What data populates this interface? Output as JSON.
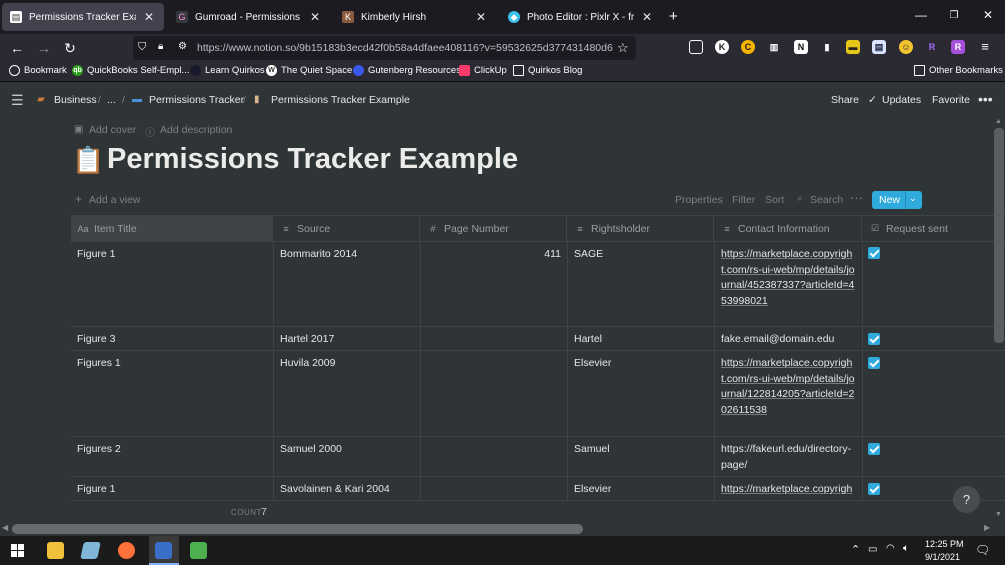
{
  "browser": {
    "tabs": [
      {
        "label": "Permissions Tracker Example",
        "active": true,
        "icon": "notion-page-icon"
      },
      {
        "label": "Gumroad - Permissions Tracker",
        "active": false,
        "icon": "gumroad-icon"
      },
      {
        "label": "Kimberly Hirsh",
        "active": false,
        "icon": "hirsh-icon"
      },
      {
        "label": "Photo Editor : Pixlr X - free imag",
        "active": false,
        "icon": "pixlr-icon"
      }
    ],
    "url": "https://www.notion.so/9b15183b3ecd42f0b58a4dfaee408116?v=59532625d377431480d6",
    "bookmarks": [
      {
        "label": "Bookmark",
        "icon": "globe-icon",
        "color": "#e6e6e5"
      },
      {
        "label": "QuickBooks Self-Empl...",
        "icon": "quickbooks-icon",
        "color": "#2ca01c"
      },
      {
        "label": "Learn Quirkos",
        "icon": "quirkos-icon",
        "color": "#1a1a2e"
      },
      {
        "label": "The Quiet Space",
        "icon": "wordpress-icon",
        "color": "#e6e6e5"
      },
      {
        "label": "Gutenberg Resources",
        "icon": "gutenberg-icon",
        "color": "#3858e9"
      },
      {
        "label": "ClickUp",
        "icon": "clickup-icon",
        "color": "#ff3b6b"
      },
      {
        "label": "Quirkos Blog",
        "icon": "folder-icon",
        "color": "#e6e6e5"
      }
    ],
    "other_bookmarks": "Other Bookmarks"
  },
  "notion": {
    "breadcrumbs": [
      "Business",
      "...",
      "Permissions Tracker",
      "Permissions Tracker Example"
    ],
    "share": "Share",
    "updates": "Updates",
    "favorite": "Favorite",
    "add_cover": "Add cover",
    "add_description": "Add description",
    "page_title": "Permissions Tracker Example",
    "page_emoji": "📋",
    "add_view": "Add a view",
    "toolbar": {
      "properties": "Properties",
      "filter": "Filter",
      "sort": "Sort",
      "search": "Search",
      "new": "New"
    },
    "columns": [
      "Item Title",
      "Source",
      "Page Number",
      "Rightsholder",
      "Contact Information",
      "Request sent"
    ],
    "rows": [
      {
        "title": "Figure 1",
        "source": "Bommarito 2014",
        "page": "411",
        "rightsholder": "SAGE",
        "contact": "https://marketplace.copyright.com/rs-ui-web/mp/details/journal/452387337?articleId=453998021",
        "sent": true
      },
      {
        "title": "Figure 3",
        "source": "Hartel 2017",
        "page": "",
        "rightsholder": "Hartel",
        "contact": "fake.email@domain.edu",
        "sent": true
      },
      {
        "title": "Figures 1",
        "source": "Huvila 2009",
        "page": "",
        "rightsholder": "Elsevier",
        "contact": "https://marketplace.copyright.com/rs-ui-web/mp/details/journal/122814205?articleId=202611538",
        "sent": true
      },
      {
        "title": "Figures 2",
        "source": "Samuel 2000",
        "page": "",
        "rightsholder": "Samuel",
        "contact": "https://fakeurl.edu/directory-page/",
        "sent": true
      },
      {
        "title": "Figure 1",
        "source": "Savolainen & Kari 2004",
        "page": "",
        "rightsholder": "Elsevier",
        "contact": "https://marketplace.copyright.",
        "sent": true
      }
    ],
    "count_label": "COUNT",
    "count_value": "7",
    "help": "?"
  },
  "taskbar": {
    "time": "12:25 PM",
    "date": "9/1/2021"
  }
}
